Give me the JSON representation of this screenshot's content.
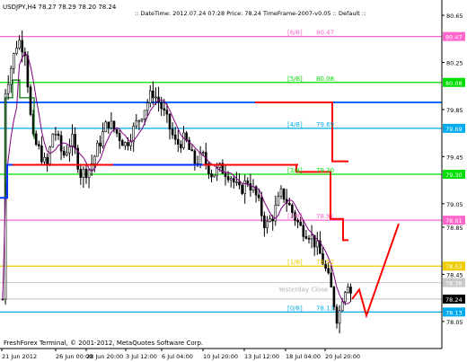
{
  "header": {
    "symbol_label": "USDJPY,H4  78.27 78.29 78.20 78.24",
    "info_label": ":: DateTime: 2012.07.24 07:28    Price: 78.24    TimeFrame-2007-v0.05   ::  Default  ::"
  },
  "footer": {
    "copyright": "FreshForex Terminal, © 2001-2012, MetaQuotes Software Corp."
  },
  "chart_data": {
    "type": "candlestick",
    "symbol": "USDJPY",
    "timeframe": "H4",
    "ohlc_last": {
      "open": 78.27,
      "high": 78.29,
      "low": 78.2,
      "close": 78.24
    },
    "ylim": [
      77.82,
      80.78
    ],
    "y_ticks": [
      80.65,
      80.25,
      79.85,
      79.45,
      79.05,
      78.85,
      78.45,
      78.05
    ],
    "x_ticks": [
      "21 Jun 2012",
      "26 Jun 00:00",
      "28 Jun 20:00",
      "3 Jul 12:00",
      "6 Jul 04:00",
      "10 Jul 20:00",
      "13 Jul 12:00",
      "18 Jul 04:00",
      "20 Jul 20:00"
    ],
    "murrey_levels": [
      {
        "tag": "[6/8]",
        "value": "80.47",
        "price": 80.47,
        "color": "#ff66cc",
        "axis_label": "80.47"
      },
      {
        "tag": "[5/8]",
        "value": "80.08",
        "price": 80.08,
        "color": "#00dd00",
        "axis_label": "80.08"
      },
      {
        "tag": "",
        "value": "",
        "price": 79.91,
        "color": "#0066ff",
        "axis_label": ""
      },
      {
        "tag": "[4/8]",
        "value": "79.69",
        "price": 79.69,
        "color": "#00aaee",
        "axis_label": "79.69"
      },
      {
        "tag": "[3/8]",
        "value": "79.30",
        "price": 79.3,
        "color": "#00dd00",
        "axis_label": "79.30"
      },
      {
        "tag": "[2/8]",
        "value": "78.91",
        "price": 78.91,
        "color": "#ff66cc",
        "axis_label": "78.91"
      },
      {
        "tag": "[1/8]",
        "value": "78.52",
        "price": 78.52,
        "color": "#eecc00",
        "axis_label": "78.52"
      },
      {
        "tag": "[0/8]",
        "value": "78.13",
        "price": 78.13,
        "color": "#00aaee",
        "axis_label": "78.13"
      }
    ],
    "yesterday_close": {
      "label": "Yesterday Close",
      "price": 78.38,
      "axis_label": "78.38"
    },
    "current_price": {
      "price": 78.24,
      "axis_label": "78.24"
    },
    "colors": {
      "up_candle": "#000000",
      "down_candle": "#000000",
      "ma_line": "#800080",
      "step_line_blue": "#0033ff",
      "step_line_red": "#ff0000",
      "step_line_dark_green": "#006600",
      "projection": "#ff0000"
    }
  }
}
